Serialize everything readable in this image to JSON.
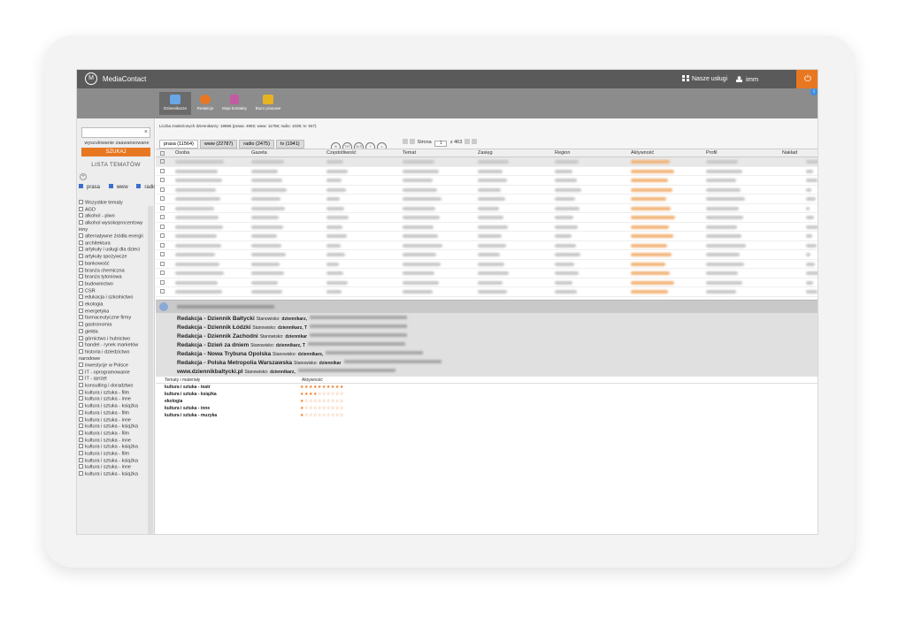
{
  "app": {
    "name": "MediaContact",
    "services": "Nasze usługi",
    "user": "imm"
  },
  "nav": [
    {
      "label": "Dziennikarze",
      "color": "#6aa7e6"
    },
    {
      "label": "Redakcje",
      "color": "#e87722"
    },
    {
      "label": "Moje kontakty",
      "color": "#c45aa3"
    },
    {
      "label": "Biuro prasowe",
      "color": "#e8b322"
    }
  ],
  "sidebar": {
    "search_placeholder": "",
    "advanced": "wyszukiwanie zaawansowane",
    "search_button": "SZUKAJ",
    "topics_header": "LISTA TEMATÓW",
    "types": [
      "prasa",
      "www",
      "radio",
      "tv"
    ],
    "all_topics": "Wszystkie tematy",
    "topics": [
      "AGD",
      "alkohol - piwo",
      "alkohol wysokoprocentowy",
      "inny",
      "alternatywne źródła energii",
      "architektura",
      "artykuły i usługi dla dzieci",
      "artykuły spożywcze",
      "bankowość",
      "branża chemiczna",
      "branża tytoniowa",
      "budownictwo",
      "CSR",
      "edukacja i szkolnictwo",
      "ekologia",
      "energetyka",
      "farmaceutyczne firmy",
      "gastronomia",
      "giełda",
      "górnictwo i hutnictwo",
      "handel - rynek marketów",
      "historia i dziedzictwo",
      "narodowe",
      "inwestycje w Polsce",
      "IT - oprogramowanie",
      "IT - sprzęt",
      "konsulting i doradztwo",
      "kultura i sztuka - film",
      "kultura i sztuka - inne",
      "kultura i sztuka - książka",
      "kultura i sztuka - film",
      "kultura i sztuka - inne",
      "kultura i sztuka - książka",
      "kultura i sztuka - film",
      "kultura i sztuka - inne",
      "kultura i sztuka - książka",
      "kultura i sztuka - film",
      "kultura i sztuka - książka",
      "kultura i sztuka - inne",
      "kultura i sztuka - książka"
    ]
  },
  "main": {
    "count_text": "Liczba znalezionych dziennikarzy: 18666 (prasa: 4992; www: 11758; radio: 1039; tv: 947)",
    "tabs": [
      "prasa (11564)",
      "www (22787)",
      "radio (2475)",
      "tv (1941)"
    ],
    "tools": [
      "",
      "TXT",
      "XLS",
      "+",
      ""
    ],
    "pager": {
      "label": "Strona",
      "page": "1",
      "of": "z 463"
    },
    "columns": [
      "Osoba",
      "Gazeta",
      "Częstotliwość",
      "Temat",
      "Zasięg",
      "Region",
      "Aktywność",
      "Profil",
      "Nakład"
    ]
  },
  "detail": {
    "editions": [
      {
        "name": "Redakcja - Dziennik Bałtycki",
        "pos_label": "Stanowisko:",
        "pos": "dziennikarz,"
      },
      {
        "name": "Redakcja - Dziennik Łódzki",
        "pos_label": "Stanowisko:",
        "pos": "dziennikarz, T"
      },
      {
        "name": "Redakcja - Dziennik Zachodni",
        "pos_label": "Stanowisko:",
        "pos": "dziennikar"
      },
      {
        "name": "Redakcja - Dzień za dniem",
        "pos_label": "Stanowisko:",
        "pos": "dziennikarz, T"
      },
      {
        "name": "Redakcja - Nowa Trybuna Opolska",
        "pos_label": "Stanowisko:",
        "pos": "dziennikarz,"
      },
      {
        "name": "Redakcja - Polska Metropolia Warszawska",
        "pos_label": "Stanowisko:",
        "pos": "dziennikar"
      },
      {
        "name": "www.dziennikbaltycki.pl",
        "pos_label": "Stanowisko:",
        "pos": "dziennikarz,"
      }
    ]
  },
  "themes": {
    "col1": "Tematy i materiały",
    "col2": "Aktywność",
    "rows": [
      {
        "name": "kultura i sztuka - teatr",
        "stars": "★★★★★★★★★★"
      },
      {
        "name": "kultura i sztuka - książka",
        "stars": "★★★★☆☆☆☆☆☆"
      },
      {
        "name": "ekologia",
        "stars": "★☆☆☆☆☆☆☆☆☆"
      },
      {
        "name": "kultura i sztuka - inne",
        "stars": "★☆☆☆☆☆☆☆☆☆"
      },
      {
        "name": "kultura i sztuka - muzyka",
        "stars": "★☆☆☆☆☆☆☆☆☆"
      }
    ]
  }
}
